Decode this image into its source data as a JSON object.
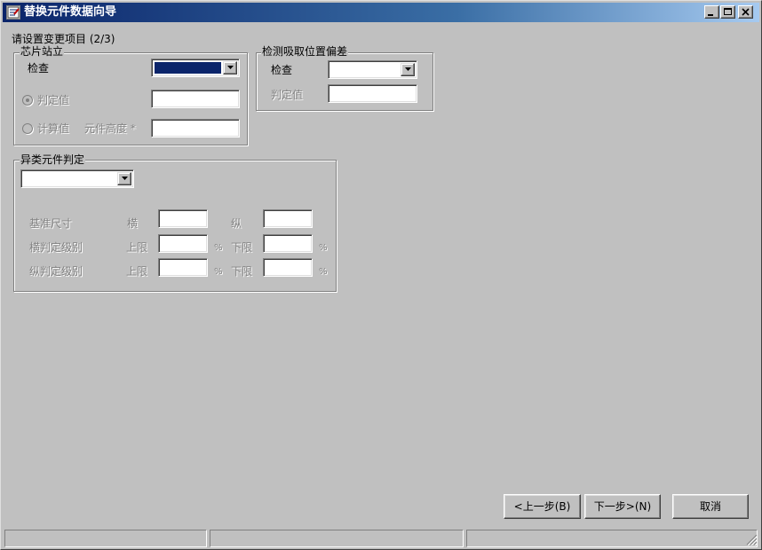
{
  "window": {
    "title": "替换元件数据向导"
  },
  "header": {
    "step_text": "请设置变更项目 (2/3)"
  },
  "chip_stand": {
    "legend": "芯片站立",
    "check_label": "检查",
    "judge_value_label": "判定值",
    "calc_value_label": "计算值",
    "component_height_label": "元件高度 *"
  },
  "pickup_offset": {
    "legend": "检测吸取位置偏差",
    "check_label": "检查",
    "judge_value_label": "判定值"
  },
  "heterogeneous": {
    "legend": "异类元件判定",
    "base_size_label": "基准尺寸",
    "horizontal_label": "横",
    "vertical_label": "纵",
    "h_level_label": "横判定级别",
    "v_level_label": "纵判定级别",
    "upper_label": "上限",
    "lower_label": "下限",
    "percent": "%"
  },
  "buttons": {
    "back_label": "<上一步(B)",
    "next_label": "下一步>(N)",
    "cancel_label": "取消"
  },
  "colors": {
    "face": "#c0c0c0",
    "title_start": "#0a246a",
    "title_end": "#a6caf0",
    "selection": "#0a246a",
    "disabled_text": "#808080"
  }
}
